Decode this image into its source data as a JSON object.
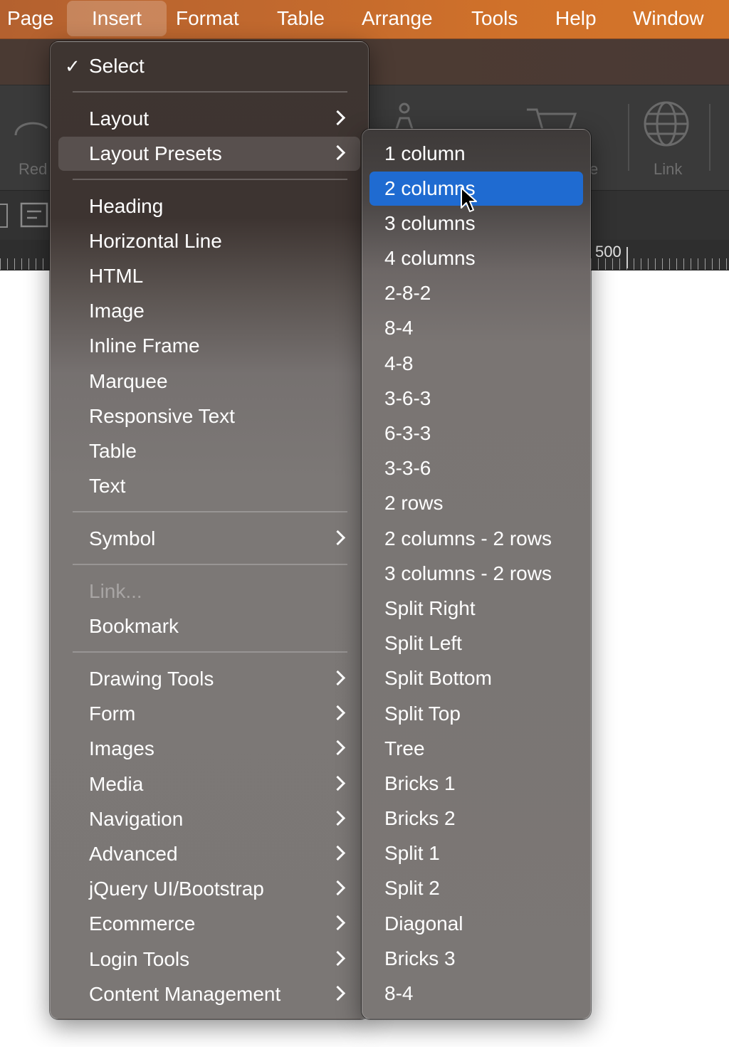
{
  "menubar": {
    "items": [
      "Page",
      "Insert",
      "Format",
      "Table",
      "Arrange",
      "Tools",
      "Help",
      "Window"
    ],
    "active": "Insert"
  },
  "toolbar": {
    "partial_left_label": "Red",
    "partial_right_label": "e",
    "link_label": "Link"
  },
  "ruler": {
    "label": "500"
  },
  "insert_menu": {
    "select": {
      "checkmark": "✓",
      "label": "Select"
    },
    "layout": "Layout",
    "layout_presets": "Layout Presets",
    "group_basic": [
      "Heading",
      "Horizontal Line",
      "HTML",
      "Image",
      "Inline Frame",
      "Marquee",
      "Responsive Text",
      "Table",
      "Text"
    ],
    "symbol": "Symbol",
    "link": "Link...",
    "bookmark": "Bookmark",
    "group_submenus": [
      "Drawing Tools",
      "Form",
      "Images",
      "Media",
      "Navigation",
      "Advanced",
      "jQuery UI/Bootstrap",
      "Ecommerce",
      "Login Tools",
      "Content Management"
    ]
  },
  "layout_presets_menu": {
    "items": [
      "1 column",
      "2 columns",
      "3 columns",
      "4 columns",
      "2-8-2",
      "8-4",
      "4-8",
      "3-6-3",
      "6-3-3",
      "3-3-6",
      "2 rows",
      "2 columns - 2 rows",
      "3 columns - 2 rows",
      "Split Right",
      "Split Left",
      "Split Bottom",
      "Split Top",
      "Tree",
      "Bricks 1",
      "Bricks 2",
      "Split 1",
      "Split 2",
      "Diagonal",
      "Bricks 3",
      "8-4"
    ],
    "selected": "2 columns"
  },
  "colors": {
    "menubar": "#c0682e",
    "selection": "#1f6bd1"
  }
}
